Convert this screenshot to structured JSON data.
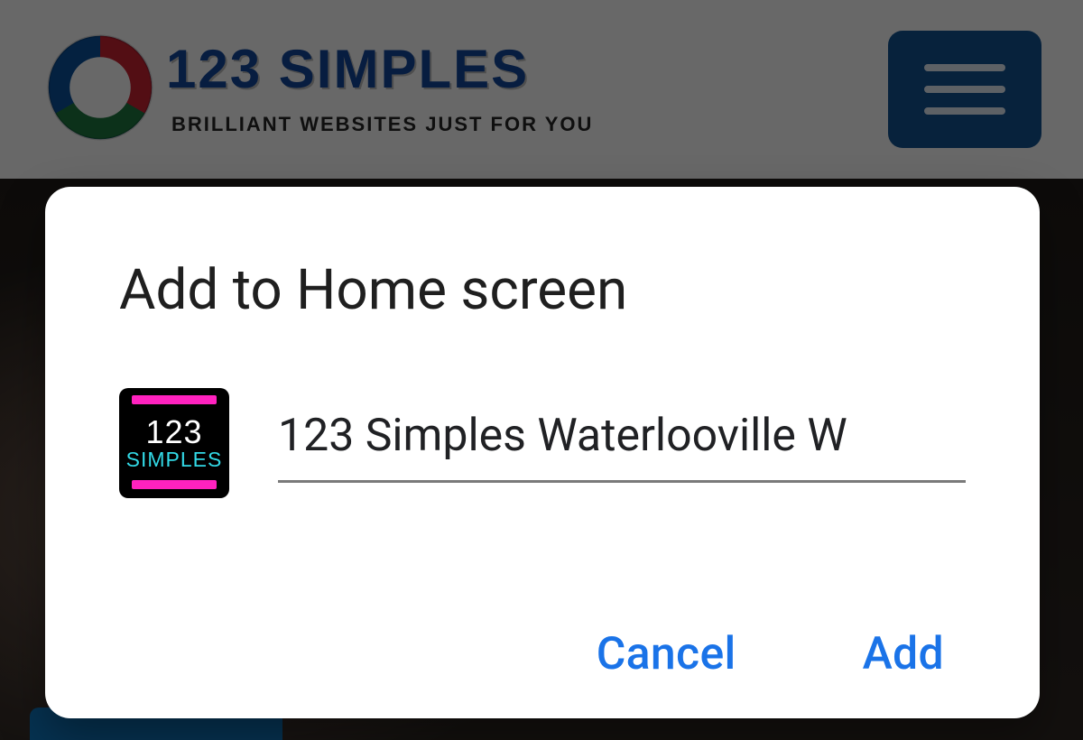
{
  "header": {
    "brand_title": "123 SIMPLES",
    "brand_tagline": "BRILLIANT WEBSITES JUST FOR YOU",
    "colors": {
      "brand_text": "#10418f",
      "hamburger_bg": "#114c85"
    }
  },
  "dialog": {
    "title": "Add to Home screen",
    "name_value": "123 Simples Waterlooville W",
    "cancel_label": "Cancel",
    "add_label": "Add",
    "colors": {
      "action_text": "#1a73e8"
    }
  },
  "app_icon": {
    "line1": "123",
    "line2": "SIMPLES",
    "colors": {
      "bg": "#000000",
      "accent": "#ff22bf",
      "line1": "#ffffff",
      "line2": "#32d9e6"
    }
  }
}
